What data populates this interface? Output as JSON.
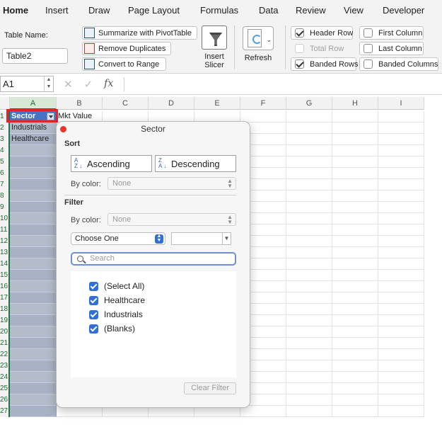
{
  "ribbon_tabs": [
    "Home",
    "Insert",
    "Draw",
    "Page Layout",
    "Formulas",
    "Data",
    "Review",
    "View",
    "Developer"
  ],
  "active_tab": "Home",
  "ribbon": {
    "table_name_label": "Table Name:",
    "table_name_value": "Table2",
    "summarize_label": "Summarize with PivotTable",
    "remove_duplicates_label": "Remove Duplicates",
    "convert_label": "Convert to Range",
    "insert_slicer_label_1": "Insert",
    "insert_slicer_label_2": "Slicer",
    "refresh_label": "Refresh",
    "options": {
      "header_row": {
        "label": "Header Row",
        "checked": true
      },
      "total_row": {
        "label": "Total Row",
        "checked": false,
        "enabled": false
      },
      "banded_rows": {
        "label": "Banded Rows",
        "checked": true
      },
      "first_column": {
        "label": "First Column",
        "checked": false
      },
      "last_column": {
        "label": "Last Column",
        "checked": false
      },
      "banded_columns": {
        "label": "Banded Columns",
        "checked": false
      }
    }
  },
  "formula_bar": {
    "name_box": "A1",
    "cancel_glyph": "✕",
    "enter_glyph": "✓",
    "fx_label": "fx"
  },
  "columns": [
    "A",
    "B",
    "C",
    "D",
    "E",
    "F",
    "G",
    "H",
    "I"
  ],
  "rows": [
    "1",
    "2",
    "3",
    "4",
    "5",
    "6",
    "7",
    "8",
    "9",
    "10",
    "11",
    "12",
    "13",
    "14",
    "15",
    "16",
    "17",
    "18",
    "19",
    "20",
    "21",
    "22",
    "23",
    "24",
    "25",
    "26",
    "27"
  ],
  "cells": {
    "A1": "Sector",
    "B1": "Mkt Value",
    "A2": "Industrials",
    "A3": "Healthcare"
  },
  "filter_popup": {
    "title": "Sector",
    "sort_heading": "Sort",
    "ascending_label": "Ascending",
    "descending_label": "Descending",
    "by_color_label": "By color:",
    "sort_color_value": "None",
    "filter_heading": "Filter",
    "filter_color_value": "None",
    "choose_one": "Choose One",
    "search_placeholder": "Search",
    "items": [
      {
        "label": "(Select All)",
        "checked": true
      },
      {
        "label": "Healthcare",
        "checked": true
      },
      {
        "label": "Industrials",
        "checked": true
      },
      {
        "label": "(Blanks)",
        "checked": true
      }
    ],
    "clear_filter_label": "Clear Filter"
  },
  "colors": {
    "excel_green": "#217346",
    "table_header": "#4472c4",
    "banded_row": "#b4bccb",
    "highlight_frame": "#e0242b",
    "checkbox_blue": "#2f6fd6"
  }
}
